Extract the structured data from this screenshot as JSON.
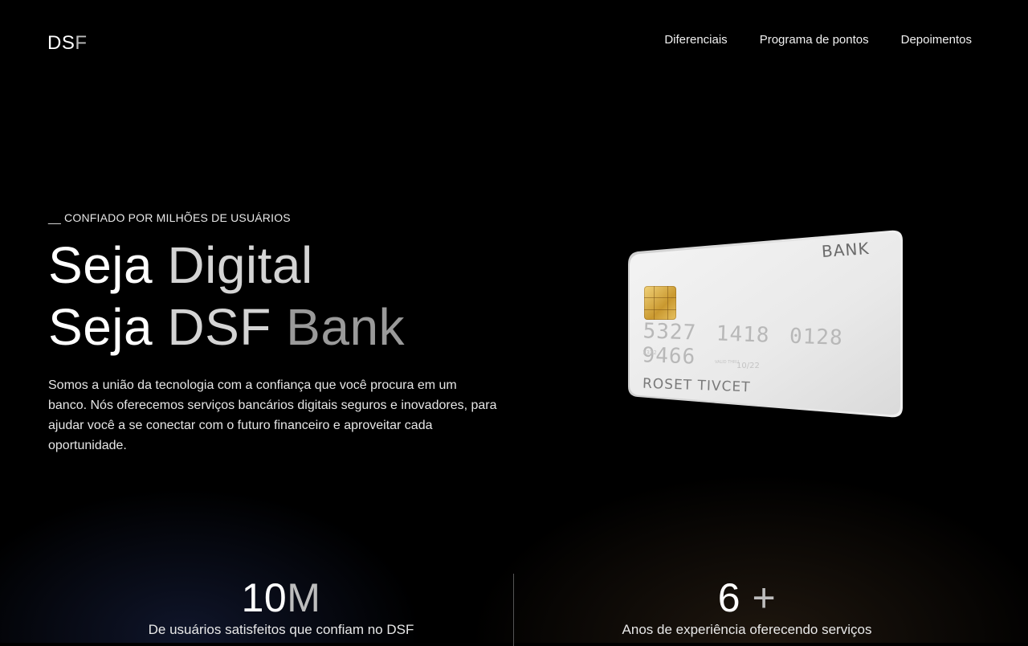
{
  "logo": {
    "part1": "DS",
    "part2": "F"
  },
  "nav": {
    "items": [
      {
        "label": "Diferenciais"
      },
      {
        "label": "Programa de pontos"
      },
      {
        "label": "Depoimentos"
      }
    ]
  },
  "hero": {
    "eyebrow": "__ CONFIADO POR MILHÕES DE USUÁRIOS",
    "line1_a": "Seja",
    "line1_b": "Digital",
    "line2_a": "Seja",
    "line2_b": "DSF",
    "line2_c": "Bank",
    "description": "Somos a união da tecnologia com a confiança que você procura em um banco. Nós oferecemos serviços bancários digitais seguros e inovadores, para ajudar você a se conectar com o futuro financeiro e aproveitar cada oportunidade."
  },
  "card": {
    "bank": "BANK",
    "number": "5327 1418 0128 9466",
    "small_code": "1322",
    "valid_label": "VALID THRU",
    "expiry": "10/22",
    "holder": "ROSET TIVCET",
    "chip_icon": "card-chip-icon"
  },
  "stats": [
    {
      "value_a": "10",
      "value_b": "M",
      "label": "De usuários satisfeitos que confiam no DSF"
    },
    {
      "value_a": "6",
      "value_b": " +",
      "label": "Anos de experiência oferecendo serviços"
    }
  ],
  "colors": {
    "background": "#000000",
    "text": "#ffffff",
    "muted": "#9a9a9a"
  }
}
